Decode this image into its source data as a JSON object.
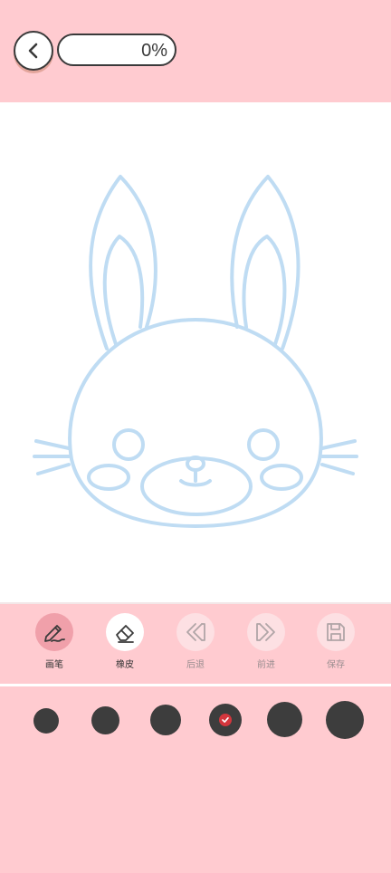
{
  "header": {
    "progress_text": "0%",
    "progress_fraction": 0
  },
  "toolbar": {
    "tools": [
      {
        "label": "画笔",
        "icon": "pencil-icon",
        "state": "active"
      },
      {
        "label": "橡皮",
        "icon": "eraser-icon",
        "state": "normal"
      },
      {
        "label": "后退",
        "icon": "undo-icon",
        "state": "disabled"
      },
      {
        "label": "前进",
        "icon": "redo-icon",
        "state": "disabled"
      },
      {
        "label": "保存",
        "icon": "save-icon",
        "state": "disabled"
      }
    ]
  },
  "brush_sizes": {
    "count": 6,
    "selected_index": 3
  },
  "colors": {
    "background": "#ffcbd0",
    "canvas": "#ffffff",
    "outline": "#bfdcf3",
    "active_tool": "#f0a0aa",
    "brush_dot": "#3d3d3d",
    "check": "#d4363d"
  }
}
